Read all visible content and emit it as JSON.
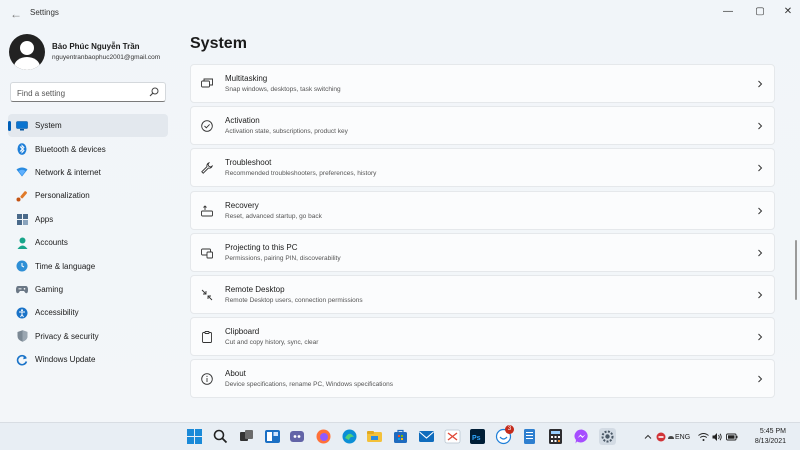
{
  "window": {
    "title": "Settings",
    "back_glyph": "←",
    "min_glyph": "—",
    "max_glyph": "▢",
    "close_glyph": "✕"
  },
  "user": {
    "name": "Bảo Phúc Nguyễn Trần",
    "email": "nguyentranbaophuc2001@gmail.com"
  },
  "search": {
    "placeholder": "Find a setting",
    "icon": "search-icon"
  },
  "sidebar": {
    "items": [
      {
        "label": "System",
        "icon": "monitor-icon",
        "selected": true
      },
      {
        "label": "Bluetooth & devices",
        "icon": "bluetooth-icon"
      },
      {
        "label": "Network & internet",
        "icon": "wifi-icon"
      },
      {
        "label": "Personalization",
        "icon": "brush-icon"
      },
      {
        "label": "Apps",
        "icon": "apps-icon"
      },
      {
        "label": "Accounts",
        "icon": "person-icon"
      },
      {
        "label": "Time & language",
        "icon": "globe-clock-icon"
      },
      {
        "label": "Gaming",
        "icon": "gamepad-icon"
      },
      {
        "label": "Accessibility",
        "icon": "accessibility-icon"
      },
      {
        "label": "Privacy & security",
        "icon": "shield-icon"
      },
      {
        "label": "Windows Update",
        "icon": "update-icon"
      }
    ]
  },
  "main": {
    "title": "System",
    "cards": [
      {
        "title": "Multitasking",
        "subtitle": "Snap windows, desktops, task switching",
        "icon": "multitasking-icon"
      },
      {
        "title": "Activation",
        "subtitle": "Activation state, subscriptions, product key",
        "icon": "check-circle-icon"
      },
      {
        "title": "Troubleshoot",
        "subtitle": "Recommended troubleshooters, preferences, history",
        "icon": "wrench-icon"
      },
      {
        "title": "Recovery",
        "subtitle": "Reset, advanced startup, go back",
        "icon": "recovery-icon"
      },
      {
        "title": "Projecting to this PC",
        "subtitle": "Permissions, pairing PIN, discoverability",
        "icon": "projector-icon"
      },
      {
        "title": "Remote Desktop",
        "subtitle": "Remote Desktop users, connection permissions",
        "icon": "remote-desktop-icon"
      },
      {
        "title": "Clipboard",
        "subtitle": "Cut and copy history, sync, clear",
        "icon": "clipboard-icon"
      },
      {
        "title": "About",
        "subtitle": "Device specifications, rename PC, Windows specifications",
        "icon": "info-icon"
      }
    ]
  },
  "taskbar": {
    "badge_count": "3",
    "language": "ENG",
    "time": "5:45 PM",
    "date": "8/13/2021",
    "colors": {
      "accent": "#005fb8",
      "badge": "#c42b1c"
    }
  }
}
